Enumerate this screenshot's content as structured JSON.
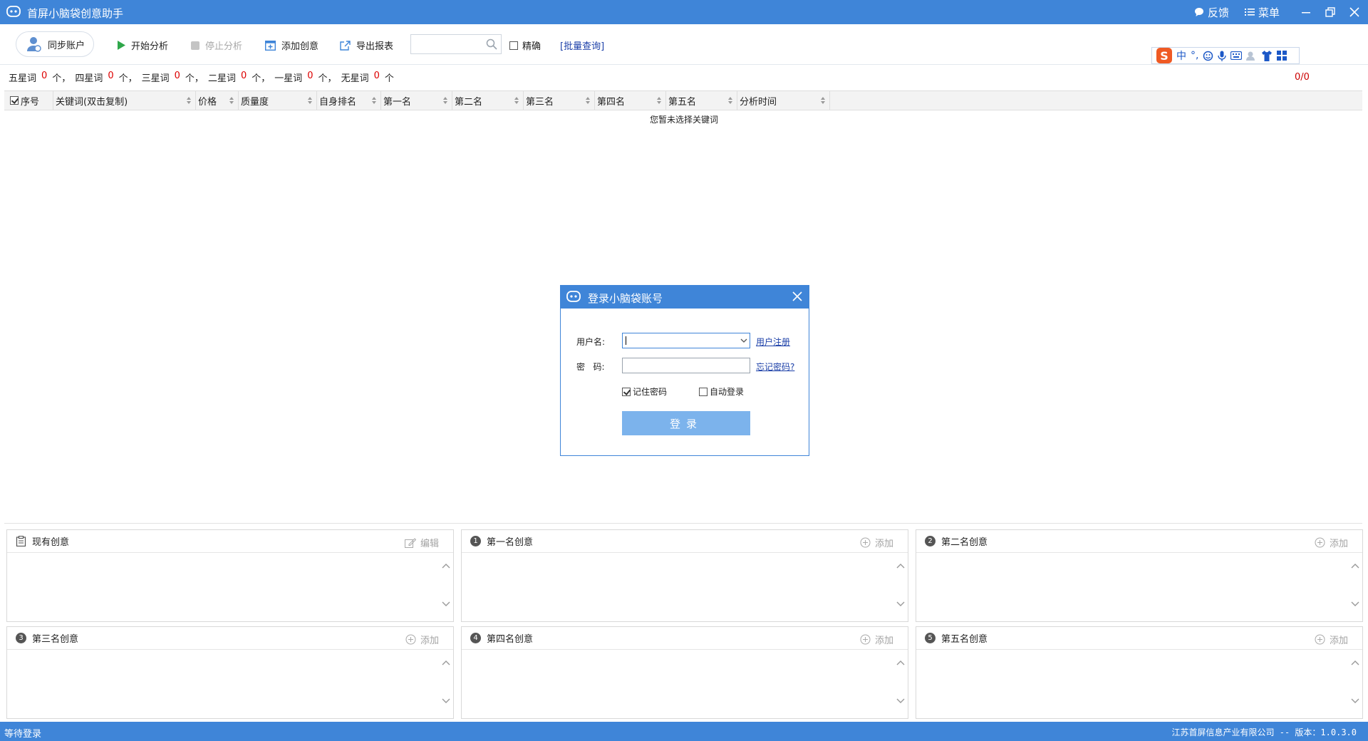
{
  "app": {
    "title": "首屏小脑袋创意助手",
    "feedback": "反馈",
    "menu": "菜单"
  },
  "toolbar": {
    "sync": "同步账户",
    "start": "开始分析",
    "stop": "停止分析",
    "add_creative": "添加创意",
    "export": "导出报表",
    "search_value": "",
    "precise": "精确",
    "batch": "[批量查询]"
  },
  "ime": {
    "logo": "S",
    "mode": "中",
    "punct": "°,"
  },
  "stats": {
    "five": {
      "label": "五星词",
      "count": "0",
      "unit": "个，"
    },
    "four": {
      "label": "四星词",
      "count": "0",
      "unit": "个，"
    },
    "three": {
      "label": "三星词",
      "count": "0",
      "unit": "个，"
    },
    "two": {
      "label": "二星词",
      "count": "0",
      "unit": "个，"
    },
    "one": {
      "label": "一星词",
      "count": "0",
      "unit": "个，"
    },
    "none": {
      "label": "无星词",
      "count": "0",
      "unit": "个"
    },
    "ratio": "0/0"
  },
  "table": {
    "columns": [
      "序号",
      "关键词(双击复制)",
      "价格",
      "质量度",
      "自身排名",
      "第一名",
      "第二名",
      "第三名",
      "第四名",
      "第五名",
      "分析时间"
    ],
    "empty": "您暂未选择关键词"
  },
  "panels": {
    "current": {
      "title": "现有创意",
      "action": "编辑"
    },
    "first": {
      "num": "1",
      "title": "第一名创意",
      "action": "添加"
    },
    "second": {
      "num": "2",
      "title": "第二名创意",
      "action": "添加"
    },
    "third": {
      "num": "3",
      "title": "第三名创意",
      "action": "添加"
    },
    "fourth": {
      "num": "4",
      "title": "第四名创意",
      "action": "添加"
    },
    "fifth": {
      "num": "5",
      "title": "第五名创意",
      "action": "添加"
    }
  },
  "status": {
    "left": "等待登录",
    "right": "江苏首屏信息产业有限公司 -- 版本：1.0.3.0"
  },
  "dialog": {
    "title": "登录小脑袋账号",
    "username_label": "用户名:",
    "username_value": "",
    "register": "用户注册",
    "password_label": "密   码:",
    "password_value": "",
    "forgot": "忘记密码?",
    "remember": "记住密码",
    "auto_login": "自动登录",
    "login": "登录"
  },
  "colors": {
    "accent": "#3f85d8",
    "stat_number": "#dd0000",
    "link": "#1b3fa8",
    "login_button": "#7cb3ec"
  }
}
